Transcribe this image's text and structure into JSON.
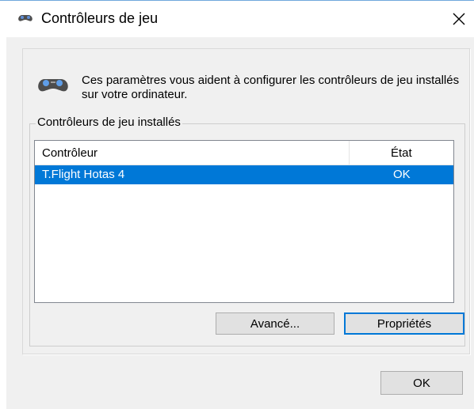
{
  "window": {
    "title": "Contrôleurs de jeu",
    "title_icon": "gamepad-icon",
    "close_icon": "close-icon"
  },
  "intro": {
    "icon": "gamepad-icon",
    "text": "Ces paramètres vous aident à configurer les contrôleurs de jeu installés sur votre ordinateur."
  },
  "group": {
    "label": "Contrôleurs de jeu installés",
    "columns": [
      "Contrôleur",
      "État"
    ],
    "rows": [
      {
        "controller": "T.Flight Hotas 4",
        "state": "OK",
        "selected": true
      }
    ]
  },
  "buttons": {
    "advanced": "Avancé...",
    "properties": "Propriétés",
    "ok": "OK"
  },
  "colors": {
    "selection": "#0078d7",
    "dialog_bg": "#f0f0f0",
    "button_bg": "#e1e1e1"
  }
}
